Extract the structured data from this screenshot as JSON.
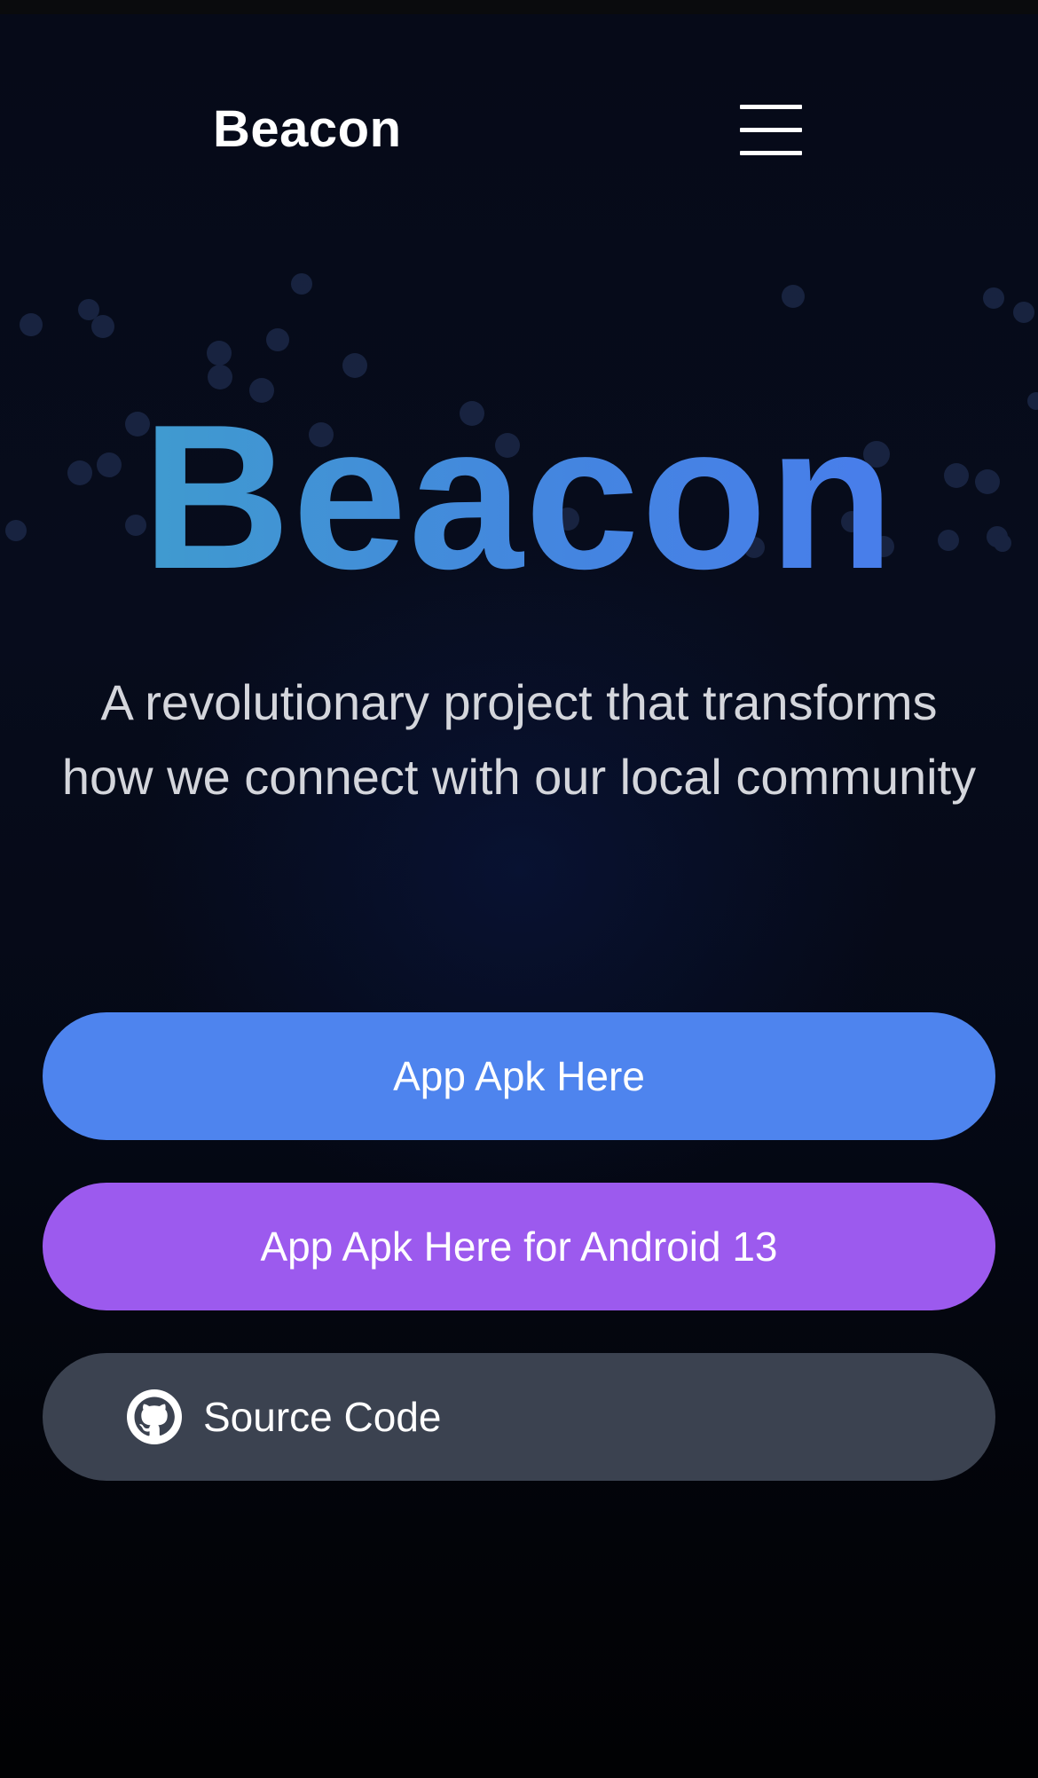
{
  "header": {
    "brand": "Beacon",
    "menu_icon": "hamburger-menu-icon"
  },
  "hero": {
    "title": "Beacon",
    "subtitle": "A revolutionary project that transforms how we connect with our local community"
  },
  "actions": {
    "apk_label": "App Apk Here",
    "apk_android13_label": "App Apk Here for Android 13",
    "source_label": "Source Code",
    "source_icon": "github-icon"
  },
  "colors": {
    "background": "#060a18",
    "title_gradient_start": "#3ea2c9",
    "title_gradient_end": "#4a7af0",
    "primary_button": "#4e84ee",
    "secondary_button": "#9c5aee",
    "source_button": "#3b4250",
    "text": "#ffffff",
    "subtitle_text": "#d4d6dc"
  }
}
